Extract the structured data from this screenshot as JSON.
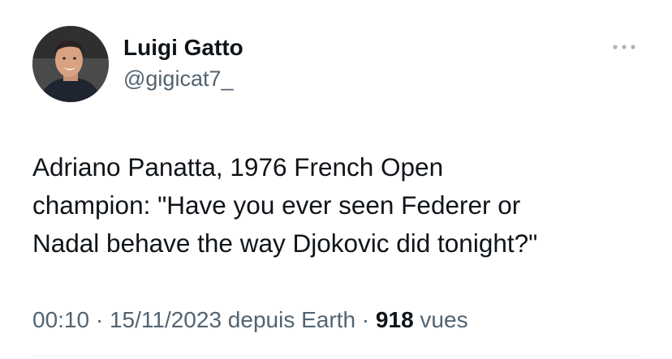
{
  "author": {
    "display_name": "Luigi Gatto",
    "handle": "@gigicat7_"
  },
  "tweet": {
    "text": "Adriano Panatta, 1976 French Open\nchampion: \"Have you ever seen Federer or\nNadal behave the way Djokovic did tonight?\""
  },
  "meta": {
    "time": "00:10",
    "separator": " · ",
    "date": "15/11/2023",
    "source": " depuis Earth",
    "separator2": " · ",
    "views_count": "918",
    "views_label": " vues"
  },
  "icons": {
    "more": "more-horizontal-icon",
    "avatar": "profile-photo"
  },
  "colors": {
    "primary_text": "#0f1419",
    "secondary_text": "#536471",
    "divider": "#eff3f4"
  }
}
